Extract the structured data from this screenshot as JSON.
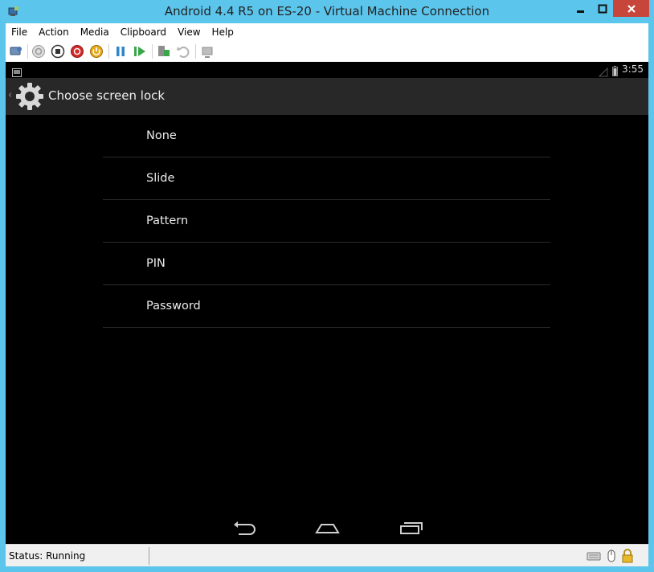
{
  "window": {
    "title": "Android 4.4 R5 on ES-20 - Virtual Machine Connection",
    "controls": [
      "minimize-icon",
      "maximize-icon",
      "close-icon"
    ]
  },
  "menu": {
    "items": [
      "File",
      "Action",
      "Media",
      "Clipboard",
      "View",
      "Help"
    ]
  },
  "toolbar": {
    "icons": [
      "ctrl-alt-del-icon",
      "start-icon",
      "turn-off-icon",
      "shutdown-icon",
      "save-icon",
      "pause-icon",
      "reset-icon",
      "checkpoint-icon",
      "revert-icon",
      "enhanced-session-icon"
    ]
  },
  "android": {
    "status": {
      "clock": "3:55"
    },
    "actionbar": {
      "title": "Choose screen lock"
    },
    "lock_options": [
      "None",
      "Slide",
      "Pattern",
      "PIN",
      "Password"
    ],
    "nav": [
      "back-icon",
      "home-icon",
      "recents-icon"
    ]
  },
  "statusbar": {
    "status": "Status: Running"
  },
  "colors": {
    "window_frame": "#5cc5ec",
    "close_button": "#c7453b",
    "android_bg": "#000000",
    "actionbar_bg": "#282828"
  }
}
